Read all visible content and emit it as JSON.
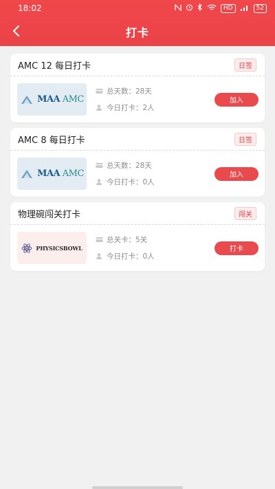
{
  "status": {
    "time": "18:02",
    "icons": [
      "nfc-icon",
      "alarm-icon",
      "bluetooth-icon",
      "wifi-icon",
      "hd-icon",
      "signal-icon"
    ],
    "hd": "HD",
    "battery": "52"
  },
  "header": {
    "title": "打卡",
    "accent": "#ea4348"
  },
  "cards": [
    {
      "title": "AMC 12 每日打卡",
      "tag": "日签",
      "logo": "MAA AMC",
      "logo_maa": "MAA",
      "logo_amc": "AMC",
      "stat1": "总天数：28天",
      "stat2": "今日打卡：2人",
      "button": "加入"
    },
    {
      "title": "AMC 8 每日打卡",
      "tag": "日签",
      "logo": "MAA AMC",
      "logo_maa": "MAA",
      "logo_amc": "AMC",
      "stat1": "总天数：28天",
      "stat2": "今日打卡：0人",
      "button": "加入"
    },
    {
      "title": "物理碗闯关打卡",
      "tag": "闯关",
      "logo": "PHYSICSBOWL",
      "stat1": "总关卡：5关",
      "stat2": "今日打卡：0人",
      "button": "打卡"
    }
  ]
}
